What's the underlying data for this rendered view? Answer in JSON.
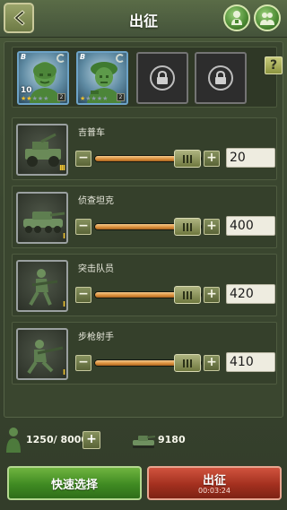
{
  "header": {
    "title": "出征",
    "back_icon": "back-arrow-icon",
    "right_icons": [
      "soldier-badge-icon",
      "soldier-group-icon"
    ]
  },
  "squad": {
    "commanders": [
      {
        "grade": "B",
        "level": "10",
        "stars_on": 2,
        "stars_total": 5,
        "rank": "2"
      },
      {
        "grade": "B",
        "level": "",
        "stars_on": 1,
        "stars_total": 5,
        "rank": "2"
      }
    ],
    "locked_slots": 2,
    "help_label": "?"
  },
  "units": [
    {
      "name": "吉普车",
      "count": "20",
      "rank": "III",
      "fill": 0.87
    },
    {
      "name": "侦查坦克",
      "count": "400",
      "rank": "I",
      "fill": 0.87
    },
    {
      "name": "突击队员",
      "count": "420",
      "rank": "I",
      "fill": 0.87
    },
    {
      "name": "步枪射手",
      "count": "410",
      "rank": "I",
      "fill": 0.87
    }
  ],
  "controls": {
    "minus_label": "−",
    "plus_label": "+"
  },
  "stats": {
    "troops": "1250/ 8000",
    "add_label": "+",
    "power": "9180"
  },
  "buttons": {
    "quick_select": "快速选择",
    "deploy": "出征",
    "deploy_time": "00:03:24"
  },
  "colors": {
    "quick_button": "#3f8a22",
    "deploy_button": "#a3301f",
    "slider_fill": "#d98d3a",
    "card_border": "#6da3c7"
  }
}
